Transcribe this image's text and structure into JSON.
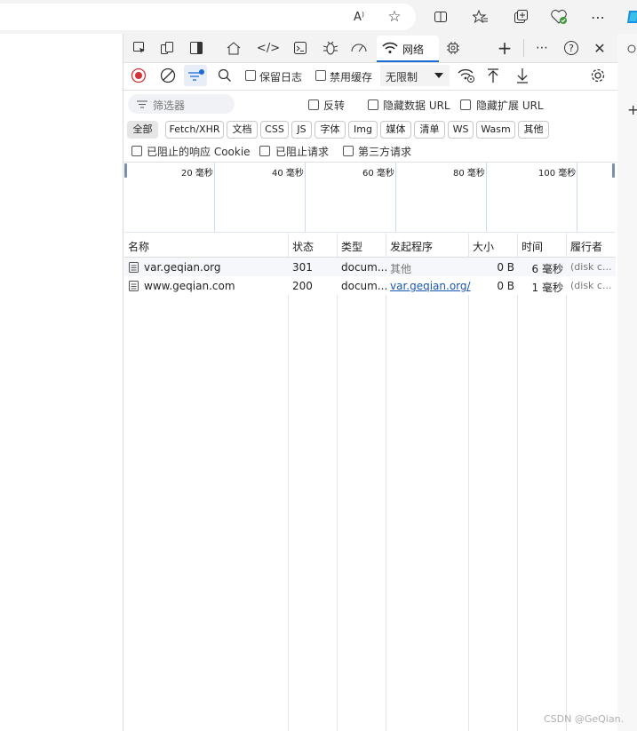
{
  "browser": {
    "read_aloud_icon": "A⁾",
    "favorite_icon": "☆"
  },
  "devtools_tabs": {
    "network_label": "网络"
  },
  "toolbar": {
    "preserve_log_label": "保留日志",
    "disable_cache_label": "禁用缓存",
    "throttling_value": "无限制"
  },
  "filter": {
    "placeholder": "筛选器",
    "invert_label": "反转",
    "hide_data_urls_label": "隐藏数据 URL",
    "hide_extension_urls_label": "隐藏扩展 URL",
    "types": [
      "全部",
      "Fetch/XHR",
      "文档",
      "CSS",
      "JS",
      "字体",
      "Img",
      "媒体",
      "清单",
      "WS",
      "Wasm",
      "其他"
    ],
    "blocked_cookies_label": "已阻止的响应 Cookie",
    "blocked_requests_label": "已阻止请求",
    "third_party_label": "第三方请求"
  },
  "overview": {
    "ticks": [
      "20 毫秒",
      "40 毫秒",
      "60 毫秒",
      "80 毫秒",
      "100 毫秒"
    ]
  },
  "table": {
    "headers": [
      "名称",
      "状态",
      "类型",
      "发起程序",
      "大小",
      "时间",
      "履行者"
    ],
    "rows": [
      {
        "name": "var.geqian.org",
        "status": "301",
        "type": "docum...",
        "initiator": "其他",
        "size": "0 B",
        "time": "6 毫秒",
        "fulfilled": "(disk c..."
      },
      {
        "name": "www.geqian.com",
        "status": "200",
        "type": "docum...",
        "initiator": "var.geqian.org/",
        "size": "0 B",
        "time": "1 毫秒",
        "fulfilled": "(disk c..."
      }
    ]
  },
  "watermark": "CSDN @GeQian.",
  "colors": {
    "accent": "#1a6bd6",
    "record_red": "#d13438"
  }
}
